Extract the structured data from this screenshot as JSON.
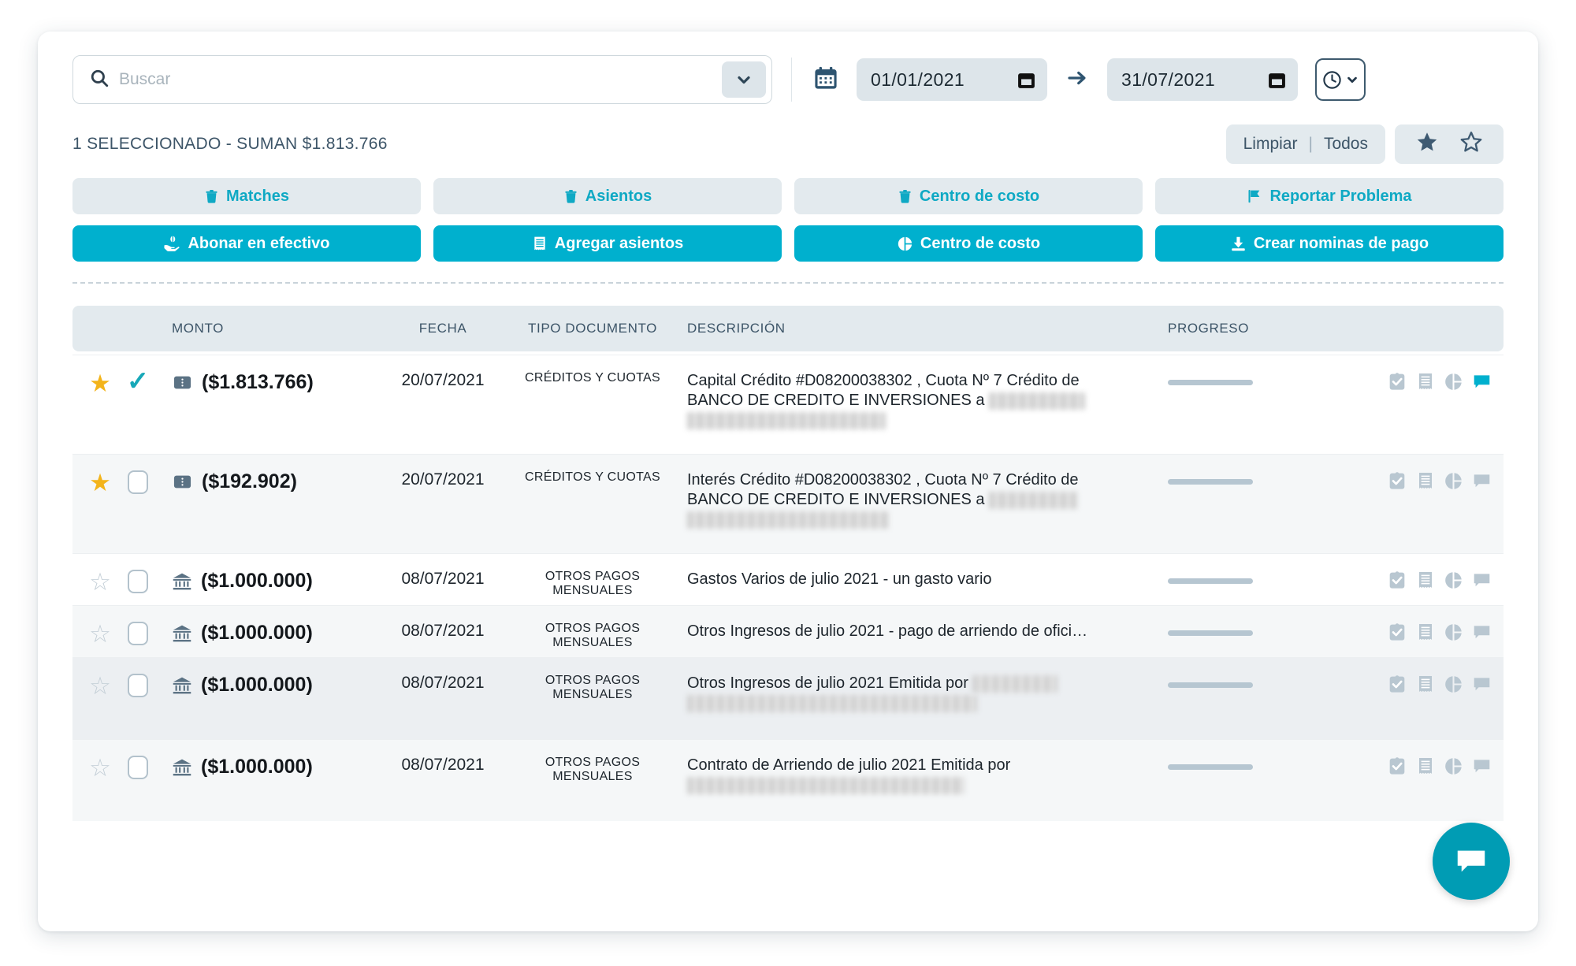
{
  "search": {
    "placeholder": "Buscar",
    "value": ""
  },
  "dates": {
    "from": "01/01/2021",
    "to": "31/07/2021"
  },
  "summary": {
    "text": "1 SELECCIONADO - SUMAN $1.813.766"
  },
  "filters": {
    "clear": "Limpiar",
    "separator": "|",
    "all": "Todos"
  },
  "actions": {
    "row1": [
      {
        "label": "Matches",
        "icon": "trash-icon",
        "style": "ghost"
      },
      {
        "label": "Asientos",
        "icon": "trash-icon",
        "style": "ghost"
      },
      {
        "label": "Centro de costo",
        "icon": "trash-icon",
        "style": "ghost"
      },
      {
        "label": "Reportar Problema",
        "icon": "flag-icon",
        "style": "ghost"
      }
    ],
    "row2": [
      {
        "label": "Abonar en efectivo",
        "icon": "hand-cash-icon",
        "style": "solid"
      },
      {
        "label": "Agregar asientos",
        "icon": "ledger-icon",
        "style": "solid"
      },
      {
        "label": "Centro de costo",
        "icon": "pie-chart-icon",
        "style": "solid"
      },
      {
        "label": "Crear nominas de pago",
        "icon": "download-icon",
        "style": "solid"
      }
    ]
  },
  "table": {
    "columns": [
      "MONTO",
      "FECHA",
      "TIPO DOCUMENTO",
      "DESCRIPCIÓN",
      "PROGRESO"
    ],
    "rows": [
      {
        "starred": true,
        "selected": true,
        "source_icon": "credit-card-icon",
        "amount": "($1.813.766)",
        "date": "20/07/2021",
        "doc_type": "CRÉDITOS Y CUOTAS",
        "description_line1": "Capital Crédito #D08200038302 , Cuota Nº 7 Crédito de",
        "description_line2": "BANCO DE CREDITO E INVERSIONES a",
        "redacted": true,
        "chat_active": true,
        "progress": 0
      },
      {
        "starred": true,
        "selected": false,
        "source_icon": "credit-card-icon",
        "amount": "($192.902)",
        "date": "20/07/2021",
        "doc_type": "CRÉDITOS Y CUOTAS",
        "description_line1": "Interés Crédito #D08200038302 , Cuota Nº 7 Crédito de",
        "description_line2": "BANCO DE CREDITO E INVERSIONES a",
        "redacted": true,
        "chat_active": false,
        "progress": 0
      },
      {
        "starred": false,
        "selected": false,
        "source_icon": "bank-icon",
        "amount": "($1.000.000)",
        "date": "08/07/2021",
        "doc_type": "OTROS PAGOS MENSUALES",
        "description_line1": "Gastos Varios de julio 2021 - un gasto vario",
        "description_line2": "",
        "redacted": false,
        "chat_active": false,
        "progress": 0
      },
      {
        "starred": false,
        "selected": false,
        "source_icon": "bank-icon",
        "amount": "($1.000.000)",
        "date": "08/07/2021",
        "doc_type": "OTROS PAGOS MENSUALES",
        "description_line1": "Otros Ingresos de julio 2021 - pago de arriendo de ofici…",
        "description_line2": "",
        "redacted": false,
        "chat_active": false,
        "progress": 0
      },
      {
        "starred": false,
        "selected": false,
        "source_icon": "bank-icon",
        "amount": "($1.000.000)",
        "date": "08/07/2021",
        "doc_type": "OTROS PAGOS MENSUALES",
        "description_line1": "Otros Ingresos de julio 2021 Emitida por",
        "description_line2": "",
        "redacted": true,
        "chat_active": false,
        "progress": 0
      },
      {
        "starred": false,
        "selected": false,
        "source_icon": "bank-icon",
        "amount": "($1.000.000)",
        "date": "08/07/2021",
        "doc_type": "OTROS PAGOS MENSUALES",
        "description_line1": "Contrato de Arriendo de julio 2021 Emitida por",
        "description_line2": "",
        "redacted": true,
        "chat_active": false,
        "progress": 0
      }
    ],
    "row_actions": [
      "clipboard-check-icon",
      "receipt-icon",
      "pie-chart-icon",
      "chat-icon"
    ]
  },
  "colors": {
    "accent": "#00b0ce",
    "accent_dark": "#009cb4",
    "ghost_bg": "#e3eaee",
    "star_on": "#f3b41b",
    "star_off": "#c3ced6",
    "text_dark": "#1d252c",
    "muted": "#3d5568"
  },
  "fab": {
    "icon": "chat-icon"
  }
}
